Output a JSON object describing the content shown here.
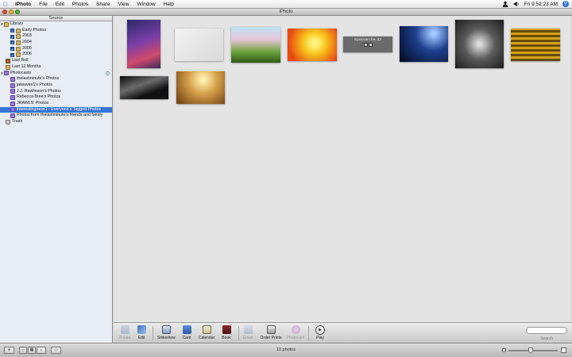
{
  "menubar": {
    "items": [
      "iPhoto",
      "File",
      "Edit",
      "Photos",
      "Share",
      "View",
      "Window",
      "Help"
    ],
    "clock": "Fri 9:52:23 AM",
    "icons": [
      "apple-icon",
      "user-icon",
      "volume-icon",
      "spotlight-icon"
    ]
  },
  "window": {
    "title": "iPhoto"
  },
  "sidebar": {
    "header": "Source",
    "library": {
      "label": "Library",
      "children": [
        "Early Photos",
        "2003",
        "2004",
        "2005",
        "2006"
      ]
    },
    "last_roll": "Last Roll",
    "last_12": "Last 12 Months",
    "photocasts": {
      "label": "Photocasts",
      "children": [
        "thelastminute's Photos",
        "jaiwaves1's Photos",
        "J.J. Rawlinson's Photos",
        "Rebecca Bree's Photos",
        "JRAWLS' Photos",
        "interestingness1 - Everyone's Tagged Photos",
        "Photos from thelastminute's friends and family"
      ],
      "selected_index": 5
    },
    "trash": "Trash"
  },
  "thumbnails": [
    {
      "name": "ferris-wheel-photo",
      "bg": "linear-gradient(160deg,#2b2a6b,#7b3fa8 45%,#d04a6a 75%,#3b2a5a)"
    },
    {
      "name": "white-bottle-photo",
      "bg": "linear-gradient(135deg,#f2f2f2,#d9d9d9)"
    },
    {
      "name": "flower-sculpture-photo",
      "bg": "linear-gradient(#bfe2f5 0%,#e9c6d9 35%,#6aa33a 70%,#2f5a1a 100%)"
    },
    {
      "name": "red-match-photo",
      "bg": "radial-gradient(circle at 55% 45%,#fff27a 10%,#f8c41a 35%,#e84a12 80%)"
    },
    {
      "name": "spamarcha-photo",
      "bg": "#6b6b6b",
      "caption": "Spamarcha 33"
    },
    {
      "name": "night-sky-photo",
      "bg": "radial-gradient(circle at 70% 20%,#9fc7ff 5%,#1e3f8f 40%,#06112e 90%)"
    },
    {
      "name": "dewy-web-photo",
      "bg": "radial-gradient(circle at 50% 50%,#dcdcdc 5%,#5a5a5a 45%,#1d1d1d 100%)"
    },
    {
      "name": "golden-grid-photo",
      "bg": "repeating-linear-gradient(0deg,#6a4b05 0 3px,#d3a21a 3px 6px)"
    },
    {
      "name": "dark-street-photo",
      "bg": "linear-gradient(160deg,#0d0d0d,#6b6b6b 40%,#111 70%)"
    },
    {
      "name": "sunset-silhouette-photo",
      "bg": "radial-gradient(circle at 55% 25%,#fff0b0 5%,#d6a04a 40%,#7a4a18 90%)"
    }
  ],
  "toolbar": {
    "tools": [
      {
        "label": "Rotate",
        "enabled": false
      },
      {
        "label": "Edit",
        "enabled": true
      },
      {
        "label": "Slideshow",
        "enabled": true
      },
      {
        "label": "Card",
        "enabled": true
      },
      {
        "label": "Calendar",
        "enabled": true
      },
      {
        "label": "Book",
        "enabled": true
      },
      {
        "label": "Email",
        "enabled": false
      },
      {
        "label": "Order Prints",
        "enabled": true
      },
      {
        "label": "Photocast",
        "enabled": false
      },
      {
        "label": "Play",
        "enabled": true
      }
    ],
    "search_label": "Search"
  },
  "statusbar": {
    "count": "10 photos",
    "zoom": 0.45
  },
  "colors": {
    "selection": "#3875d7",
    "sidebar_bg": "#e8edf5",
    "main_bg": "#e4e4e4"
  }
}
